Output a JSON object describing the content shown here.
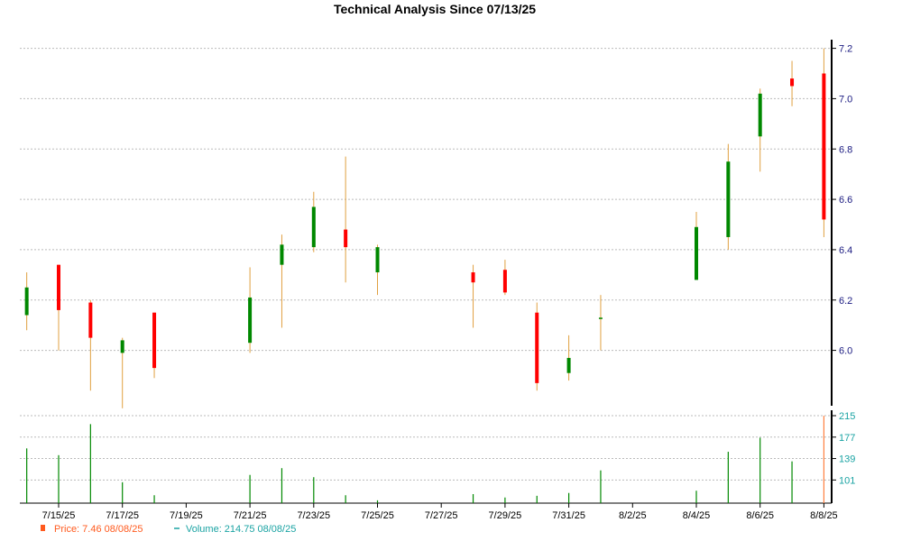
{
  "chart_data": {
    "type": "candlestick",
    "title": "Technical Analysis Since 07/13/25",
    "price_axis": {
      "ticks": [
        6.0,
        6.2,
        6.4,
        6.6,
        6.8,
        7.0,
        7.2
      ],
      "tick_labels": [
        "6.0",
        "6.2",
        "6.4",
        "6.6",
        "6.8",
        "7.0",
        "7.2"
      ],
      "ylim": [
        5.78,
        7.22
      ],
      "grid": true,
      "position": "right"
    },
    "volume_axis": {
      "ticks": [
        101,
        139,
        177,
        215
      ],
      "tick_labels": [
        "101",
        "139",
        "177",
        "215"
      ],
      "ylim": [
        60,
        215
      ],
      "grid": true,
      "position": "right"
    },
    "x_axis": {
      "tick_dates": [
        "7/15/25",
        "7/17/25",
        "7/19/25",
        "7/21/25",
        "7/23/25",
        "7/25/25",
        "7/27/25",
        "7/29/25",
        "7/31/25",
        "8/2/25",
        "8/4/25",
        "8/6/25",
        "8/8/25"
      ]
    },
    "candles": [
      {
        "date": "7/14/25",
        "open": 6.14,
        "high": 6.31,
        "low": 6.08,
        "close": 6.25
      },
      {
        "date": "7/15/25",
        "open": 6.34,
        "high": 6.34,
        "low": 6.0,
        "close": 6.16
      },
      {
        "date": "7/16/25",
        "open": 6.19,
        "high": 6.2,
        "low": 5.84,
        "close": 6.05
      },
      {
        "date": "7/17/25",
        "open": 5.99,
        "high": 6.05,
        "low": 5.77,
        "close": 6.04
      },
      {
        "date": "7/18/25",
        "open": 6.15,
        "high": 6.15,
        "low": 5.89,
        "close": 5.93
      },
      {
        "date": "7/21/25",
        "open": 6.03,
        "high": 6.33,
        "low": 5.99,
        "close": 6.21
      },
      {
        "date": "7/22/25",
        "open": 6.34,
        "high": 6.46,
        "low": 6.09,
        "close": 6.42
      },
      {
        "date": "7/23/25",
        "open": 6.41,
        "high": 6.63,
        "low": 6.39,
        "close": 6.57
      },
      {
        "date": "7/24/25",
        "open": 6.48,
        "high": 6.77,
        "low": 6.27,
        "close": 6.41
      },
      {
        "date": "7/25/25",
        "open": 6.31,
        "high": 6.42,
        "low": 6.22,
        "close": 6.41
      },
      {
        "date": "7/28/25",
        "open": 6.31,
        "high": 6.34,
        "low": 6.09,
        "close": 6.27
      },
      {
        "date": "7/29/25",
        "open": 6.32,
        "high": 6.36,
        "low": 6.22,
        "close": 6.23
      },
      {
        "date": "7/30/25",
        "open": 6.15,
        "high": 6.19,
        "low": 5.84,
        "close": 5.87
      },
      {
        "date": "7/31/25",
        "open": 5.91,
        "high": 6.06,
        "low": 5.88,
        "close": 5.97
      },
      {
        "date": "8/1/25",
        "open": 6.13,
        "high": 6.22,
        "low": 6.0,
        "close": 6.13
      },
      {
        "date": "8/4/25",
        "open": 6.28,
        "high": 6.55,
        "low": 6.28,
        "close": 6.49
      },
      {
        "date": "8/5/25",
        "open": 6.45,
        "high": 6.82,
        "low": 6.4,
        "close": 6.75
      },
      {
        "date": "8/6/25",
        "open": 6.85,
        "high": 7.04,
        "low": 6.71,
        "close": 7.02
      },
      {
        "date": "8/7/25",
        "open": 7.08,
        "high": 7.15,
        "low": 6.97,
        "close": 7.05
      },
      {
        "date": "8/8/25",
        "open": 7.1,
        "high": 7.2,
        "low": 6.45,
        "close": 6.52
      }
    ],
    "volume": [
      {
        "date": "7/14/25",
        "value": 157
      },
      {
        "date": "7/15/25",
        "value": 145
      },
      {
        "date": "7/16/25",
        "value": 200
      },
      {
        "date": "7/17/25",
        "value": 97
      },
      {
        "date": "7/18/25",
        "value": 74
      },
      {
        "date": "7/21/25",
        "value": 110
      },
      {
        "date": "7/22/25",
        "value": 122
      },
      {
        "date": "7/23/25",
        "value": 106
      },
      {
        "date": "7/24/25",
        "value": 74
      },
      {
        "date": "7/25/25",
        "value": 65
      },
      {
        "date": "7/28/25",
        "value": 76
      },
      {
        "date": "7/29/25",
        "value": 70
      },
      {
        "date": "7/30/25",
        "value": 73
      },
      {
        "date": "7/31/25",
        "value": 78
      },
      {
        "date": "8/1/25",
        "value": 118
      },
      {
        "date": "8/4/25",
        "value": 82
      },
      {
        "date": "8/5/25",
        "value": 151
      },
      {
        "date": "8/6/25",
        "value": 176
      },
      {
        "date": "8/7/25",
        "value": 134
      },
      {
        "date": "8/8/25",
        "value": 214.75
      }
    ],
    "legend": [
      {
        "label": "Price: 7.46",
        "date": "08/08/25",
        "color": "#ff5a1e",
        "marker": "square"
      },
      {
        "label": "Volume: 214.75",
        "date": "08/08/25",
        "color": "#1aa3a3",
        "marker": "dash"
      }
    ],
    "colors": {
      "up": "#008800",
      "down": "#ff0000",
      "wick": "#e0a040",
      "volume": "#008800",
      "last_volume": "#ff8040",
      "price_tick": "#1a1a80",
      "volume_tick": "#1aa3a3",
      "grid": "#bbbbbb"
    }
  }
}
